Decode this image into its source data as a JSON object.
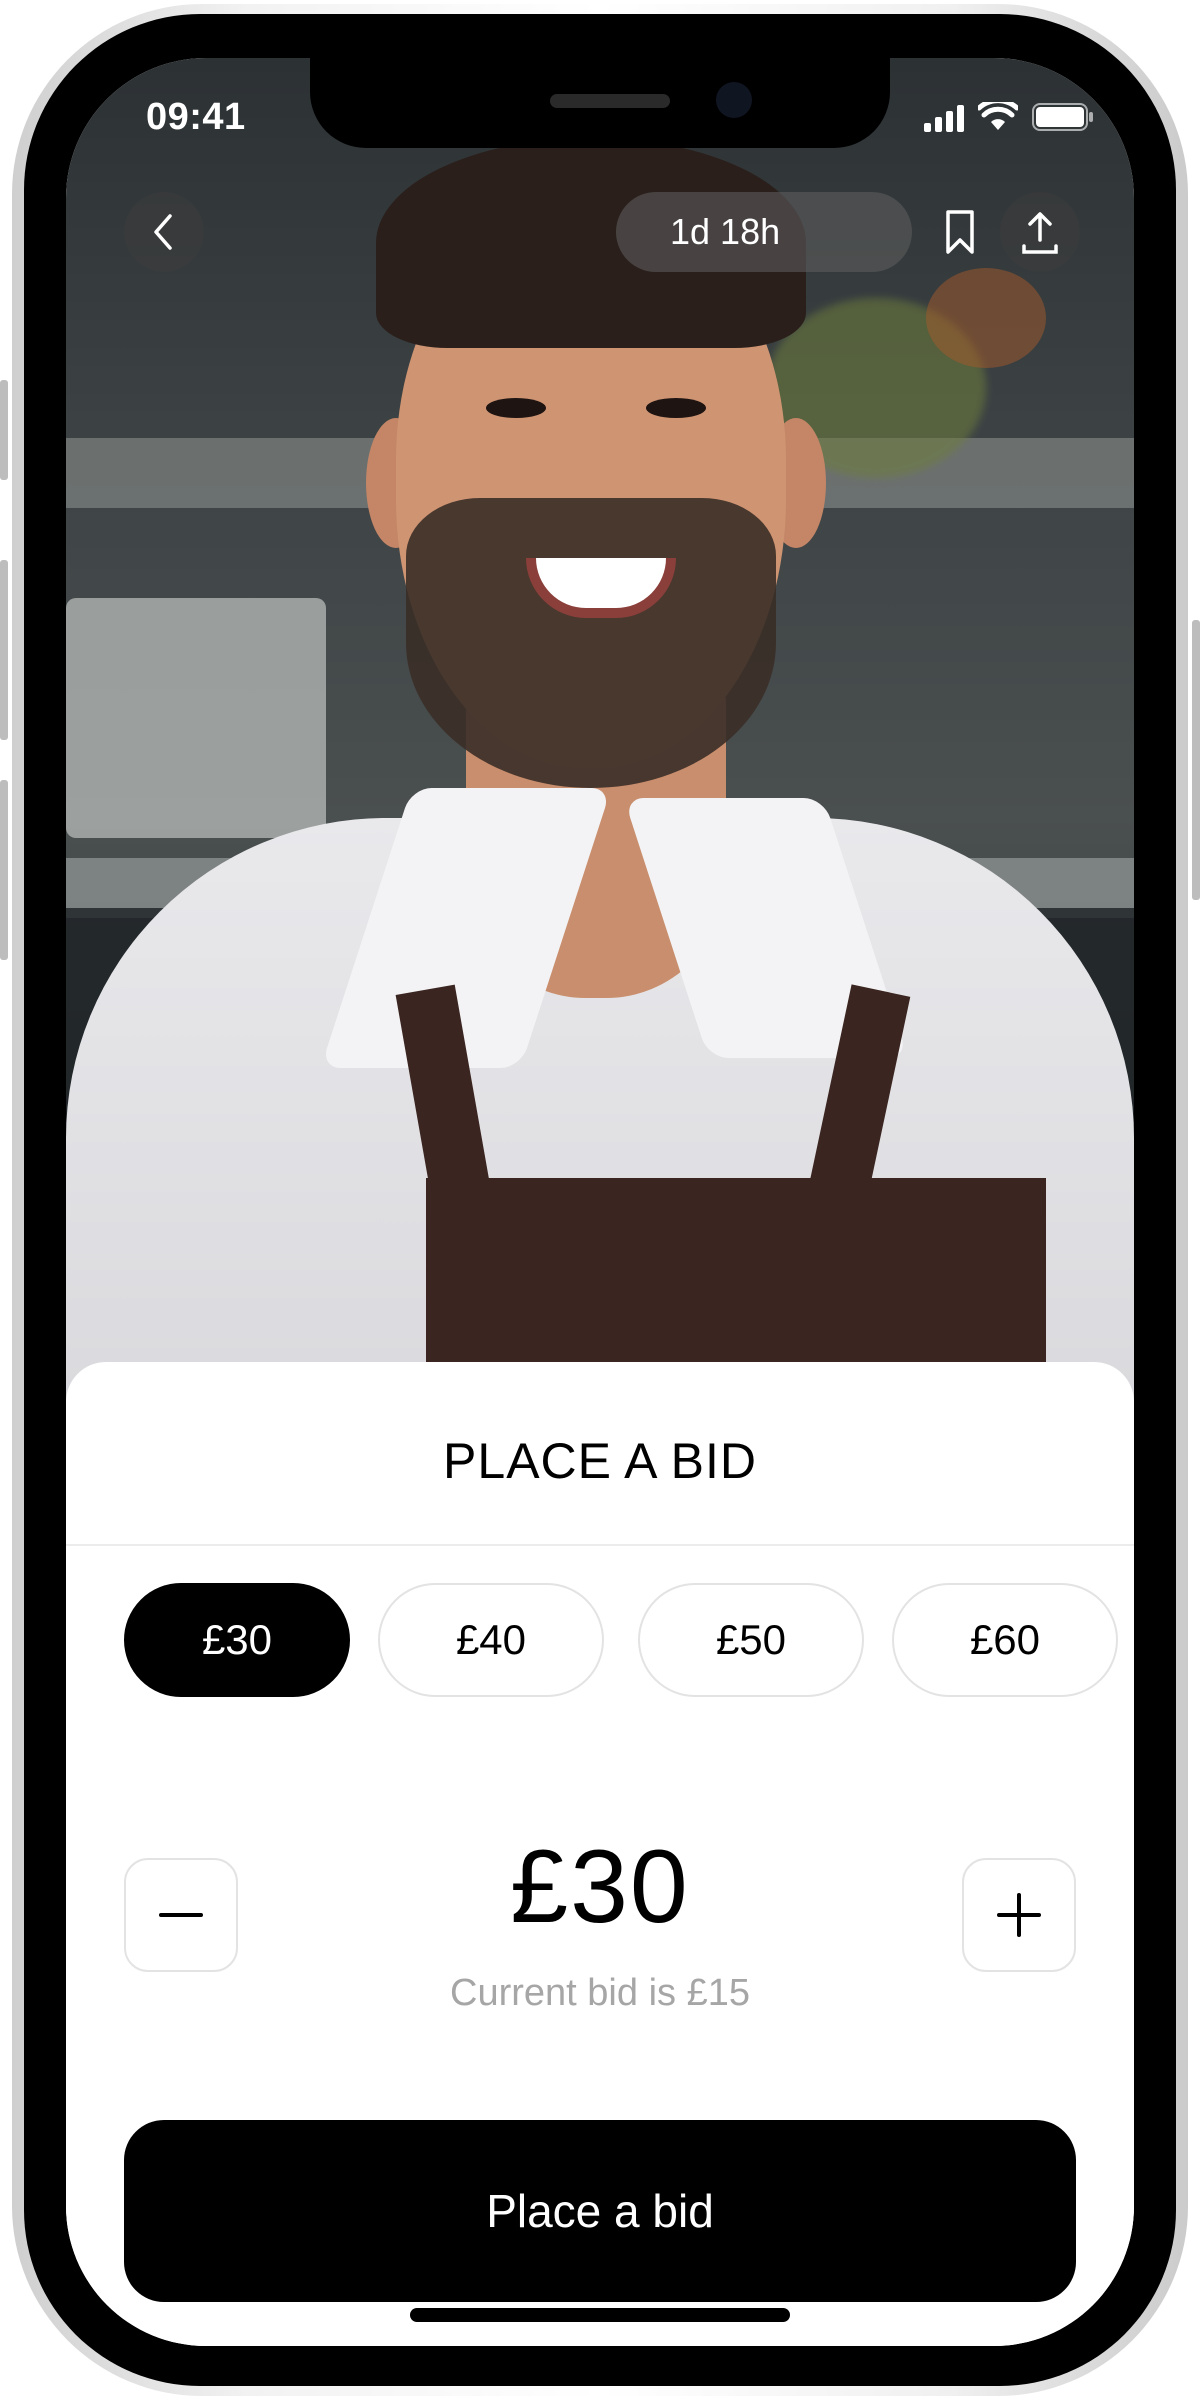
{
  "status_bar": {
    "time": "09:41"
  },
  "top_bar": {
    "timer_label": "1d 18h"
  },
  "sheet": {
    "title": "PLACE A BID",
    "chips": [
      "£30",
      "£40",
      "£50",
      "£60"
    ],
    "selected_chip": "£30",
    "amount": "£30",
    "current_bid_text": "Current bid is £15",
    "primary_button_label": "Place a bid"
  },
  "icons": {
    "back": "chevron-left-icon",
    "bookmark": "bookmark-icon",
    "share": "share-icon",
    "minus": "minus-icon",
    "plus": "plus-icon"
  },
  "colors": {
    "primary": "#000000",
    "background": "#ffffff",
    "muted_text": "#a6a6a6"
  }
}
